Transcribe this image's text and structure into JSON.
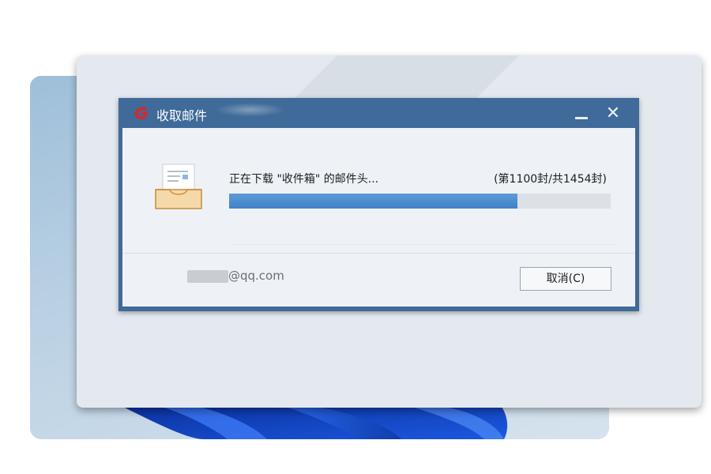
{
  "dialog": {
    "title": "收取邮件",
    "minimize_glyph": "—",
    "close_glyph": "✕",
    "status": "正在下载 \"收件箱\" 的邮件头...",
    "count": "(第1100封/共1454封)",
    "progress_percent": 75.6,
    "account_suffix": "@qq.com",
    "cancel_label": "取消(C)"
  },
  "icons": {
    "app": "foxmail-logo-icon",
    "inbox": "inbox-tray-icon"
  },
  "colors": {
    "titlebar": "#3f6a99",
    "progress": "#4a8cd0",
    "app_logo": "#d9262b"
  }
}
